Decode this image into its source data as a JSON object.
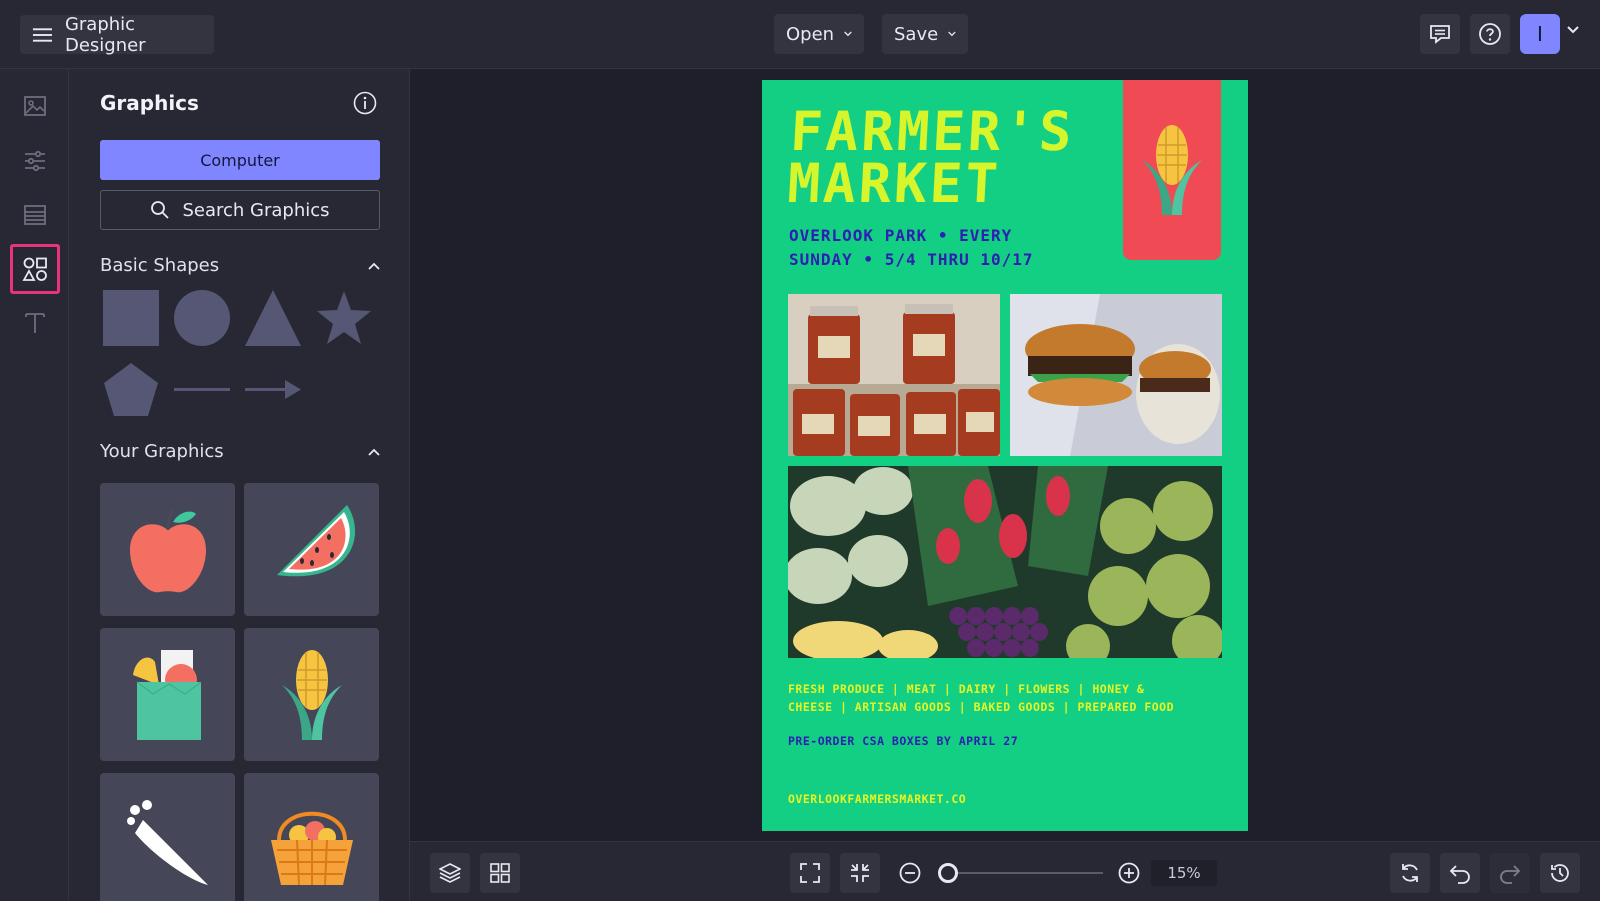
{
  "app": {
    "title": "Graphic Designer",
    "open_label": "Open",
    "save_label": "Save",
    "avatar_initial": "I"
  },
  "rail": {
    "items": [
      "image-icon",
      "sliders-icon",
      "layout-icon",
      "shapes-icon",
      "text-icon"
    ],
    "active_item": "shapes-icon"
  },
  "panel": {
    "title": "Graphics",
    "computer_label": "Computer",
    "search_label": "Search Graphics",
    "basic_shapes_title": "Basic Shapes",
    "basic_shapes": [
      "square",
      "circle",
      "triangle",
      "star",
      "pentagon",
      "line",
      "arrow"
    ],
    "your_graphics_title": "Your Graphics",
    "your_graphics": [
      "apple",
      "watermelon",
      "grocery-bag",
      "corn",
      "carrot",
      "fruit-basket"
    ]
  },
  "poster": {
    "title_line1": "FARMER'S",
    "title_line2": "MARKET",
    "subtitle_line1": "OVERLOOK PARK • EVERY",
    "subtitle_line2": "SUNDAY • 5/4 THRU 10/17",
    "list_line1": "FRESH PRODUCE | MEAT | DAIRY | FLOWERS | HONEY &",
    "list_line2": "CHEESE | ARTISAN GOODS | BAKED GOODS | PREPARED FOOD",
    "preorder": "PRE-ORDER CSA BOXES BY APRIL 27",
    "url": "OVERLOOKFARMERSMARKET.CO",
    "background_color": "#13cf84",
    "accent_color": "#f04b55"
  },
  "bottombar": {
    "zoom_value": "15%",
    "zoom_level": 0.15
  },
  "colors": {
    "accent": "#7f86ff",
    "active_outline": "#e6357a"
  }
}
